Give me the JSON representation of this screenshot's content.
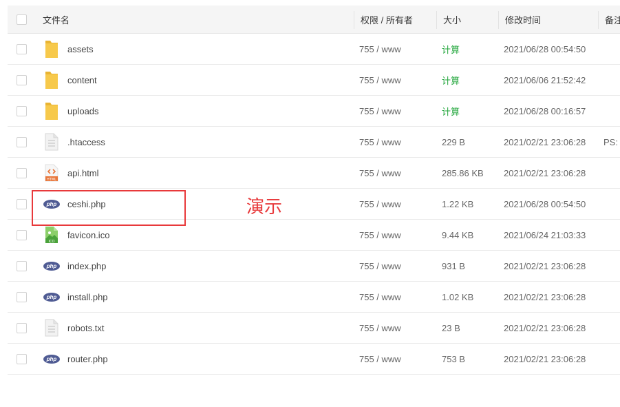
{
  "header": {
    "name": "文件名",
    "permission": "权限 / 所有者",
    "size": "大小",
    "modified": "修改时间",
    "note": "备注"
  },
  "files": [
    {
      "name": "assets",
      "icon": "folder-icon",
      "perm": "755 / www",
      "size": "计算",
      "time": "2021/06/28 00:54:50",
      "note": ""
    },
    {
      "name": "content",
      "icon": "folder-icon",
      "perm": "755 / www",
      "size": "计算",
      "time": "2021/06/06 21:52:42",
      "note": ""
    },
    {
      "name": "uploads",
      "icon": "folder-icon",
      "perm": "755 / www",
      "size": "计算",
      "time": "2021/06/28 00:16:57",
      "note": ""
    },
    {
      "name": ".htaccess",
      "icon": "text-file-icon",
      "perm": "755 / www",
      "size": "229 B",
      "time": "2021/02/21 23:06:28",
      "note": "PS: A"
    },
    {
      "name": "api.html",
      "icon": "html-file-icon",
      "perm": "755 / www",
      "size": "285.86 KB",
      "time": "2021/02/21 23:06:28",
      "note": ""
    },
    {
      "name": "ceshi.php",
      "icon": "php-file-icon",
      "perm": "755 / www",
      "size": "1.22 KB",
      "time": "2021/06/28 00:54:50",
      "note": ""
    },
    {
      "name": "favicon.ico",
      "icon": "image-file-icon",
      "perm": "755 / www",
      "size": "9.44 KB",
      "time": "2021/06/24 21:03:33",
      "note": ""
    },
    {
      "name": "index.php",
      "icon": "php-file-icon",
      "perm": "755 / www",
      "size": "931 B",
      "time": "2021/02/21 23:06:28",
      "note": ""
    },
    {
      "name": "install.php",
      "icon": "php-file-icon",
      "perm": "755 / www",
      "size": "1.02 KB",
      "time": "2021/02/21 23:06:28",
      "note": ""
    },
    {
      "name": "robots.txt",
      "icon": "text-file-icon",
      "perm": "755 / www",
      "size": "23 B",
      "time": "2021/02/21 23:06:28",
      "note": ""
    },
    {
      "name": "router.php",
      "icon": "php-file-icon",
      "perm": "755 / www",
      "size": "753 B",
      "time": "2021/02/21 23:06:28",
      "note": ""
    }
  ],
  "php_badge_text": "php",
  "html_badge_text": "HTML",
  "ico_badge_text": "ICO",
  "annotation": {
    "label": "演示",
    "color": "#e8393b"
  },
  "colors": {
    "calc_link": "#20a53a",
    "folder": "#f7c94b",
    "php": "#4f5b93",
    "html": "#e8763a"
  }
}
